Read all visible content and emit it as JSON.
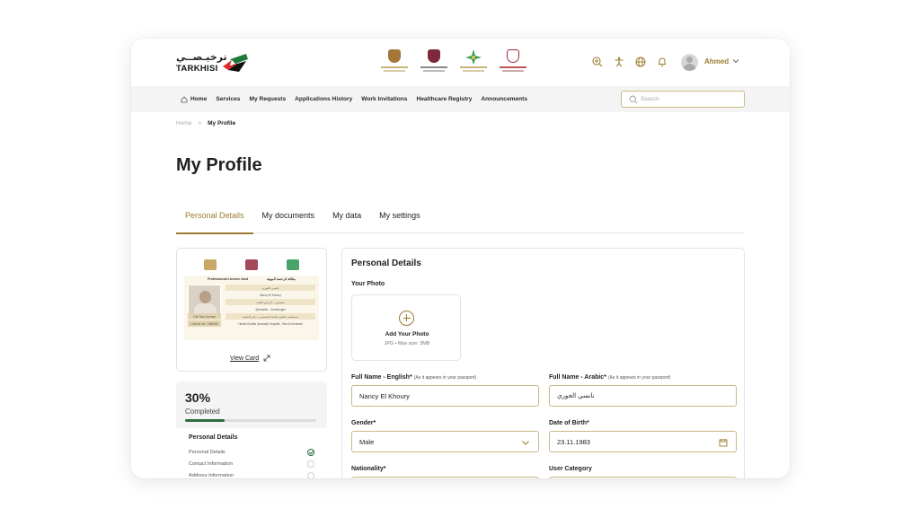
{
  "brand": {
    "name_ar": "ترخيـصــي",
    "name_en": "TARKHISI",
    "flag_colors": [
      "#1f7a3a",
      "#e02a2a",
      "#111111"
    ]
  },
  "gov_logos": [
    {
      "name": "ministry-of-health-logo",
      "color": "#a3773a"
    },
    {
      "name": "department-of-health-logo",
      "color": "#7d2a3a"
    },
    {
      "name": "dubai-health-authority-logo",
      "color": "#3a9a5a"
    },
    {
      "name": "sharjah-health-logo",
      "color": "#a82a3a"
    }
  ],
  "header": {
    "icons": [
      "zoom-in-icon",
      "accessibility-icon",
      "globe-icon",
      "bell-icon"
    ],
    "username": "Ahmed"
  },
  "nav": {
    "items": [
      {
        "label": "Home",
        "icon": "home-icon"
      },
      {
        "label": "Services"
      },
      {
        "label": "My Requests"
      },
      {
        "label": "Applications History"
      },
      {
        "label": "Work Invitations"
      },
      {
        "label": "Healthcare Registry"
      },
      {
        "label": "Announcements"
      }
    ],
    "search_placeholder": "Search"
  },
  "breadcrumb": {
    "home": "Home",
    "separator": ">",
    "current": "My Profile"
  },
  "page_title": "My Profile",
  "tabs": [
    {
      "label": "Personal Details",
      "active": true
    },
    {
      "label": "My documents",
      "active": false
    },
    {
      "label": "My data",
      "active": false
    },
    {
      "label": "My settings",
      "active": false
    }
  ],
  "license_card": {
    "title_en": "Professional License Card",
    "title_ar": "بطاقة الرخصة المهنية",
    "rows": [
      "نانسي الخوري",
      "Nancy El Khoury",
      "تخصصي - أمراض القلب",
      "Specialist - Cardiologist",
      "مستشفى الشيخ خليفة التخصصي - رأس الخيمة",
      "Health Khalifa Specialty Hospital - Ras Al Khaimah"
    ],
    "chips": [
      "Full Time License",
      "License No. 7456068"
    ],
    "view_label": "View Card"
  },
  "progress": {
    "percent_label": "30%",
    "percent_value": 30,
    "completed_label": "Completed",
    "steps_title": "Personal Details",
    "steps": [
      {
        "label": "Personal Details",
        "done": true
      },
      {
        "label": "Contact Information",
        "done": false
      },
      {
        "label": "Address Information",
        "done": false
      }
    ]
  },
  "form": {
    "title": "Personal Details",
    "photo_label": "Your Photo",
    "add_photo": "Add Your Photo",
    "photo_hint": "JPG • Max size: 3MB",
    "full_name_en_label": "Full Name - English*",
    "full_name_en_hint": "(As it appears in your passport)",
    "full_name_en_value": "Nancy El Khoury",
    "full_name_ar_label": "Full Name  - Arabic*",
    "full_name_ar_hint": "(As it appears in your passport)",
    "full_name_ar_value": "نانسي الخوري",
    "gender_label": "Gender*",
    "gender_value": "Male",
    "dob_label": "Date of Birth*",
    "dob_value": "23.11.1983",
    "nationality_label": "Nationality*",
    "user_category_label": "User Category"
  },
  "colors": {
    "accent": "#9b7b2f",
    "field_border": "#c9b887",
    "progress": "#2e6b3f"
  }
}
